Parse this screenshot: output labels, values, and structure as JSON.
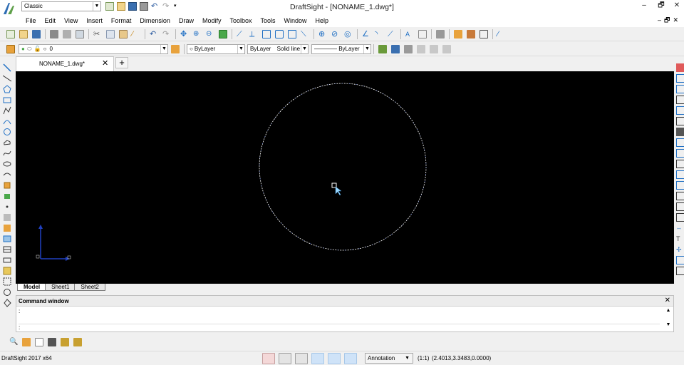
{
  "window": {
    "title": "DraftSight - [NONAME_1.dwg*]",
    "workspace": "Classic",
    "min": "–",
    "restore": "🗗",
    "close": "✕"
  },
  "menu": {
    "items": [
      "File",
      "Edit",
      "View",
      "Insert",
      "Format",
      "Dimension",
      "Draw",
      "Modify",
      "Toolbox",
      "Tools",
      "Window",
      "Help"
    ],
    "mdi_controls": "–🗗✕"
  },
  "toolbar2": {
    "layer": "0",
    "color": "ByLayer",
    "linetype_label": "ByLayer",
    "linetype_style": "Solid line",
    "lineweight": "———— ByLayer"
  },
  "document": {
    "tab_label": "NONAME_1.dwg*",
    "tab_close": "✕",
    "new_tab": "+"
  },
  "sheets": {
    "tabs": [
      "Model",
      "Sheet1",
      "Sheet2"
    ]
  },
  "command_window": {
    "title": "Command window",
    "close": "✕",
    "line1": ":",
    "line2": ":"
  },
  "status": {
    "app": "DraftSight 2017 x64",
    "annotation": "Annotation",
    "scale": "(1:1)",
    "coordinates": "(2.4013,3.3483,0.0000)"
  },
  "colors": {
    "canvas_bg": "#000000",
    "accent_blue": "#1f6fc4",
    "tool_orange": "#e8a23c",
    "tool_green": "#4aa84a"
  }
}
